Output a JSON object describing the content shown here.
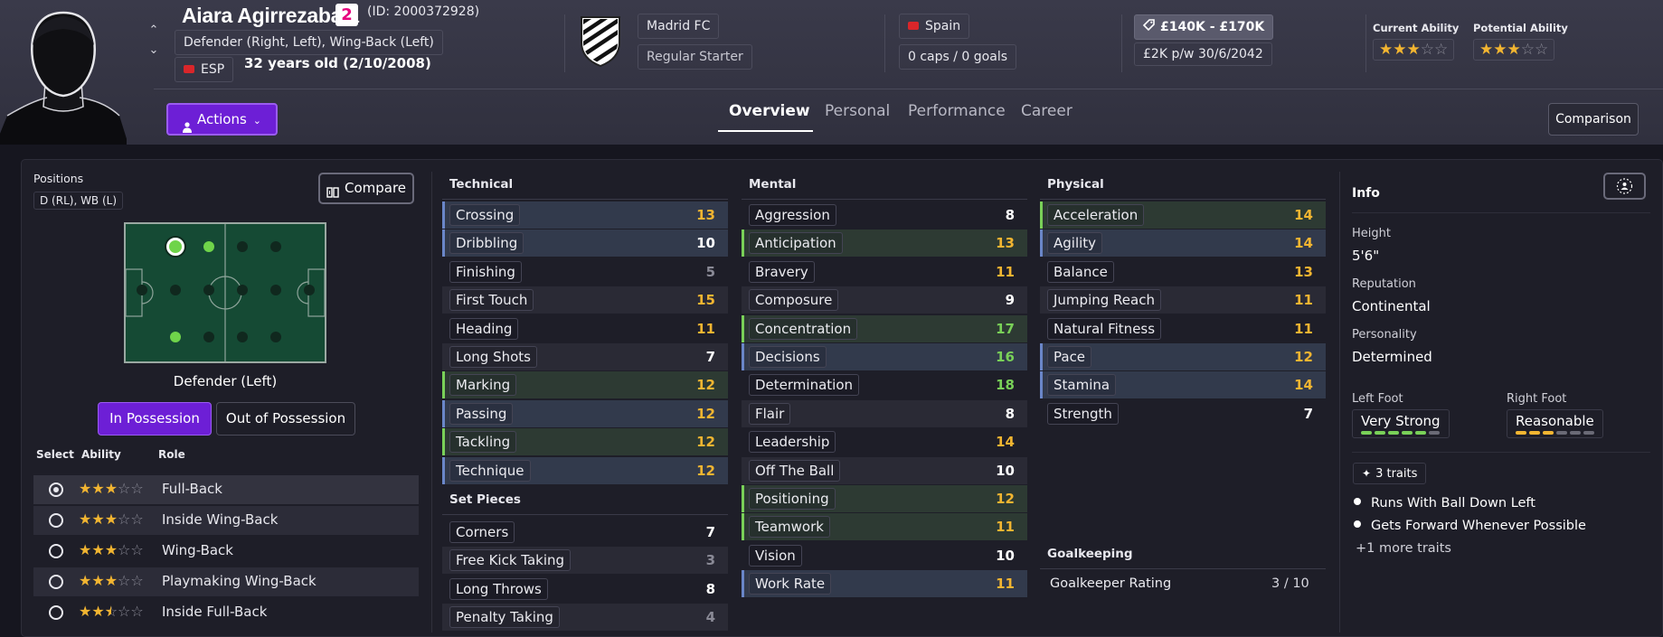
{
  "player": {
    "name": "Aiara Agirrezabala",
    "squad_number": "2",
    "id_text": "(ID: 2000372928)",
    "positions_text": "Defender (Right, Left), Wing-Back (Left)",
    "nationality_code": "ESP",
    "age_text": "32 years old (2/10/2008)"
  },
  "club": {
    "name": "Madrid FC",
    "squad_status": "Regular Starter"
  },
  "nation": {
    "name": "Spain",
    "caps_text": "0 caps / 0 goals"
  },
  "contract": {
    "value": "£140K - £170K",
    "wage": "£2K p/w",
    "expiry": "30/6/2042"
  },
  "ability": {
    "current_label": "Current Ability",
    "current_stars": 3,
    "potential_label": "Potential Ability",
    "potential_stars": 3
  },
  "header": {
    "actions_label": "Actions",
    "tabs": [
      "Overview",
      "Personal",
      "Performance",
      "Career"
    ],
    "active_tab": "Overview",
    "comparison_label": "Comparison"
  },
  "positions_panel": {
    "title": "Positions",
    "positions_short": "D (RL), WB (L)",
    "compare_label": "Compare",
    "selected_position": "Defender (Left)",
    "in_possession_label": "In Possession",
    "out_possession_label": "Out of Possession",
    "role_headers": [
      "Select",
      "Ability",
      "Role"
    ],
    "roles": [
      {
        "name": "Full-Back",
        "stars": 3,
        "selected": true
      },
      {
        "name": "Inside Wing-Back",
        "stars": 3,
        "selected": false
      },
      {
        "name": "Wing-Back",
        "stars": 3,
        "selected": false
      },
      {
        "name": "Playmaking Wing-Back",
        "stars": 3,
        "selected": false
      },
      {
        "name": "Inside Full-Back",
        "stars": 2.5,
        "selected": false
      }
    ]
  },
  "attributes": {
    "technical_title": "Technical",
    "technical": [
      {
        "name": "Crossing",
        "value": "13"
      },
      {
        "name": "Dribbling",
        "value": "10"
      },
      {
        "name": "Finishing",
        "value": "5"
      },
      {
        "name": "First Touch",
        "value": "15"
      },
      {
        "name": "Heading",
        "value": "11"
      },
      {
        "name": "Long Shots",
        "value": "7"
      },
      {
        "name": "Marking",
        "value": "12"
      },
      {
        "name": "Passing",
        "value": "12"
      },
      {
        "name": "Tackling",
        "value": "12"
      },
      {
        "name": "Technique",
        "value": "12"
      }
    ],
    "set_pieces_title": "Set Pieces",
    "set_pieces": [
      {
        "name": "Corners",
        "value": "7"
      },
      {
        "name": "Free Kick Taking",
        "value": "3"
      },
      {
        "name": "Long Throws",
        "value": "8"
      },
      {
        "name": "Penalty Taking",
        "value": "4"
      }
    ],
    "mental_title": "Mental",
    "mental": [
      {
        "name": "Aggression",
        "value": "8"
      },
      {
        "name": "Anticipation",
        "value": "13"
      },
      {
        "name": "Bravery",
        "value": "11"
      },
      {
        "name": "Composure",
        "value": "9"
      },
      {
        "name": "Concentration",
        "value": "17"
      },
      {
        "name": "Decisions",
        "value": "16"
      },
      {
        "name": "Determination",
        "value": "18"
      },
      {
        "name": "Flair",
        "value": "8"
      },
      {
        "name": "Leadership",
        "value": "14"
      },
      {
        "name": "Off The Ball",
        "value": "10"
      },
      {
        "name": "Positioning",
        "value": "12"
      },
      {
        "name": "Teamwork",
        "value": "11"
      },
      {
        "name": "Vision",
        "value": "10"
      },
      {
        "name": "Work Rate",
        "value": "11"
      }
    ],
    "physical_title": "Physical",
    "physical": [
      {
        "name": "Acceleration",
        "value": "14"
      },
      {
        "name": "Agility",
        "value": "14"
      },
      {
        "name": "Balance",
        "value": "13"
      },
      {
        "name": "Jumping Reach",
        "value": "11"
      },
      {
        "name": "Natural Fitness",
        "value": "11"
      },
      {
        "name": "Pace",
        "value": "12"
      },
      {
        "name": "Stamina",
        "value": "14"
      },
      {
        "name": "Strength",
        "value": "7"
      }
    ],
    "goalkeeping_title": "Goalkeeping",
    "goalkeeper_rating_label": "Goalkeeper Rating",
    "goalkeeper_rating_value": "3 / 10"
  },
  "info": {
    "title": "Info",
    "height_label": "Height",
    "height": "5'6\"",
    "reputation_label": "Reputation",
    "reputation": "Continental",
    "personality_label": "Personality",
    "personality": "Determined",
    "left_foot_label": "Left Foot",
    "left_foot": "Very Strong",
    "left_foot_level": 5,
    "right_foot_label": "Right Foot",
    "right_foot": "Reasonable",
    "right_foot_level": 3,
    "traits_chip": "3 traits",
    "traits": [
      "Runs With Ball Down Left",
      "Gets Forward Whenever Possible"
    ],
    "more_traits": "+1 more traits"
  }
}
